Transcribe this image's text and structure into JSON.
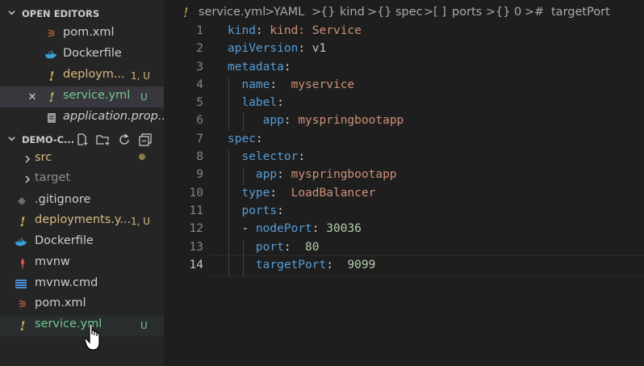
{
  "sidebar": {
    "open_editors_title": "OPEN EDITORS",
    "open_editors": [
      {
        "label": "pom.xml",
        "icon": "rss-icon",
        "badge": ""
      },
      {
        "label": "Dockerfile",
        "icon": "docker-icon",
        "badge": ""
      },
      {
        "label": "deploym...",
        "icon": "yaml-exclamation-icon",
        "badge": "1, U"
      },
      {
        "label": "service.yml",
        "icon": "yaml-exclamation-icon",
        "badge": "U"
      },
      {
        "label": "application.prop...",
        "icon": "settings-file-icon",
        "badge": ""
      }
    ],
    "project_title": "DEMO-C...",
    "project_items": [
      {
        "label": "src",
        "badge": "•"
      },
      {
        "label": "target",
        "badge": ""
      },
      {
        "label": ".gitignore",
        "badge": ""
      },
      {
        "label": "deployments.y...",
        "badge": "1, U"
      },
      {
        "label": "Dockerfile",
        "badge": ""
      },
      {
        "label": "mvnw",
        "badge": ""
      },
      {
        "label": "mvnw.cmd",
        "badge": ""
      },
      {
        "label": "pom.xml",
        "badge": ""
      },
      {
        "label": "service.yml",
        "badge": "U"
      }
    ],
    "toolbar_icons": [
      "new-file-icon",
      "new-folder-icon",
      "refresh-icon",
      "collapse-all-icon"
    ],
    "close_glyph": "✕"
  },
  "breadcrumb": {
    "file_icon": "!",
    "file": "service.yml",
    "sep": ">",
    "lang": "YAML",
    "obj_icon": "{}",
    "arr_icon": "[ ]",
    "field_icon": "#",
    "kind": "kind",
    "spec": "spec",
    "ports": "ports",
    "index": "0",
    "target": "targetPort"
  },
  "code": {
    "line_numbers": [
      "1",
      "2",
      "3",
      "4",
      "5",
      "6",
      "7",
      "8",
      "9",
      "10",
      "11",
      "12",
      "13",
      "14"
    ],
    "active_line": "14",
    "l1_key": "kind",
    "l1_colon": ":",
    "l1_val": "kind: Service",
    "l2_key": "apiVersion",
    "l2_val": "v1",
    "l3_key": "metadata",
    "l4_key": "name",
    "l4_val": "myservice",
    "l5_key": "label",
    "l6_key": "app",
    "l6_val": "myspringbootapp",
    "l7_key": "spec",
    "l8_key": "selector",
    "l9_key": "app",
    "l9_val": "myspringbootapp",
    "l10_key": "type",
    "l10_val": "LoadBalancer",
    "l11_key": "ports",
    "l12_dash": "- ",
    "l12_key": "nodePort",
    "l12_val": "30036",
    "l13_key": "port",
    "l13_val": "80",
    "l14_key": "targetPort",
    "l14_val": "9099"
  },
  "colors": {
    "yaml_key": "#569cd6",
    "yaml_string": "#ce9178",
    "yaml_number": "#b5cea8",
    "git_modified": "#d7ba7d",
    "git_untracked": "#73c991"
  }
}
